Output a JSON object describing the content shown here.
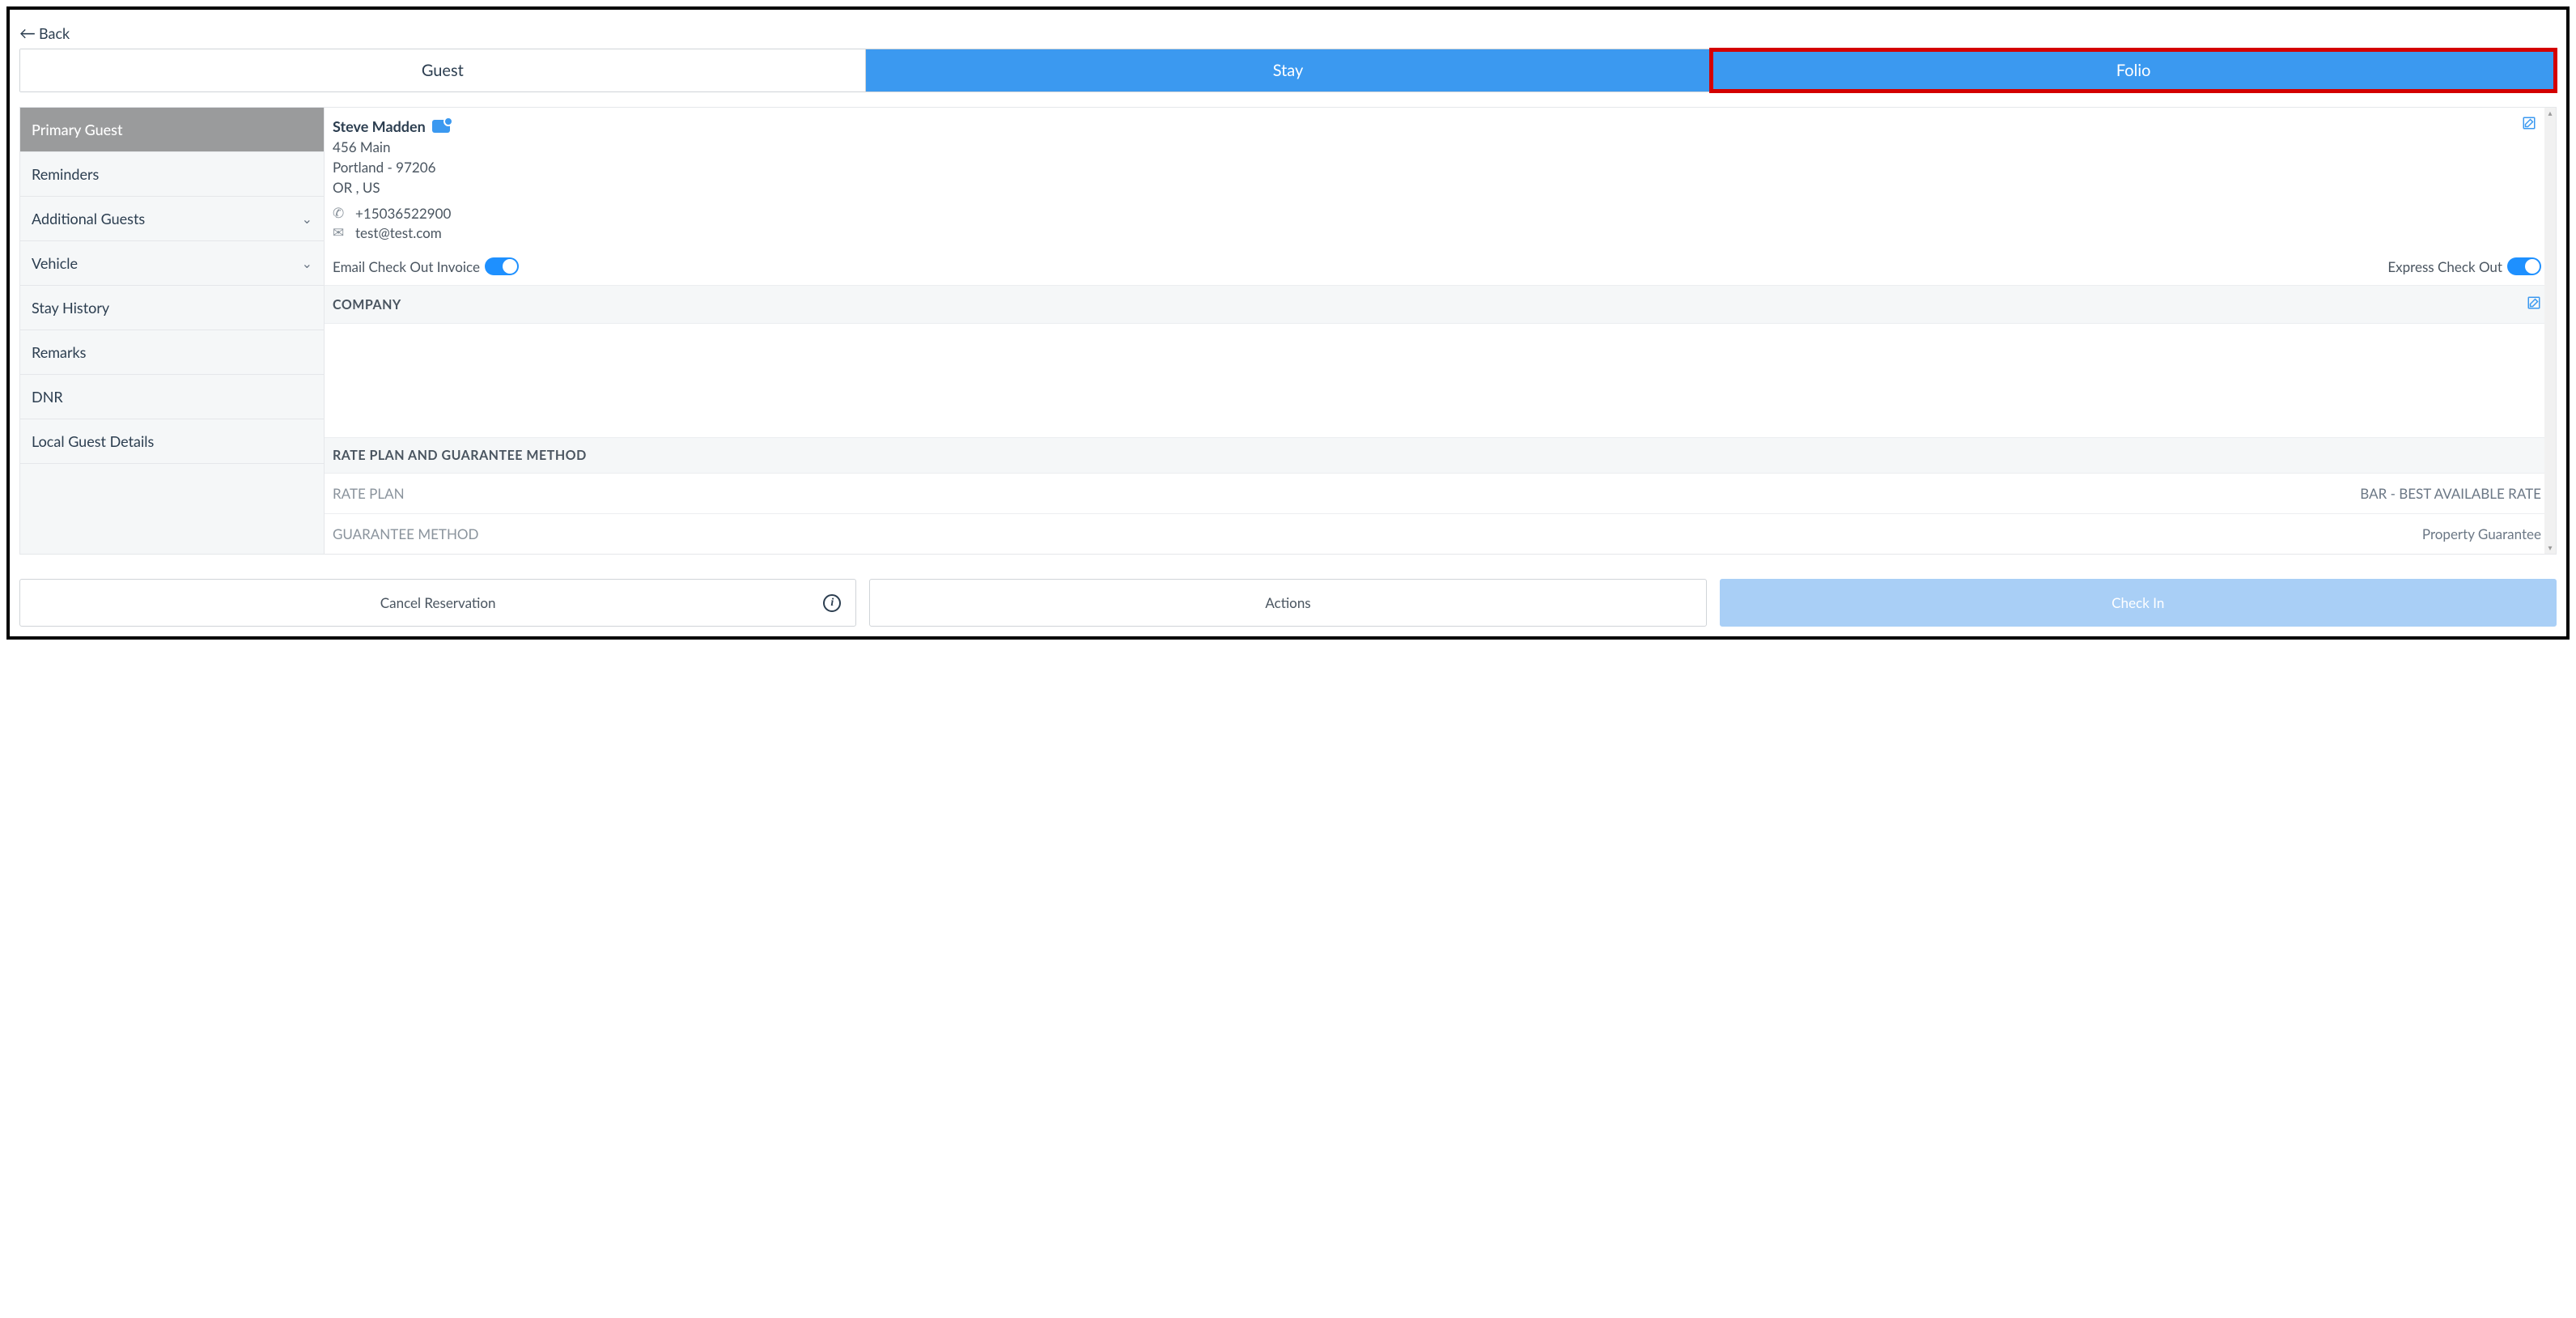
{
  "back_label": "Back",
  "tabs": {
    "guest": "Guest",
    "stay": "Stay",
    "folio": "Folio"
  },
  "sidebar": {
    "items": [
      {
        "label": "Primary Guest",
        "active": true
      },
      {
        "label": "Reminders"
      },
      {
        "label": "Additional Guests",
        "chevron": true
      },
      {
        "label": "Vehicle",
        "chevron": true
      },
      {
        "label": "Stay History"
      },
      {
        "label": "Remarks"
      },
      {
        "label": "DNR"
      },
      {
        "label": "Local Guest Details"
      }
    ]
  },
  "guest": {
    "name": "Steve Madden",
    "addr1": "456 Main",
    "addr2": "Portland  - 97206",
    "addr3": "OR , US",
    "phone": "+15036522900",
    "email": "test@test.com",
    "email_checkout_label": "Email Check Out Invoice",
    "express_checkout_label": "Express Check Out"
  },
  "sections": {
    "company": "COMPANY",
    "rate_plan_heading": "RATE PLAN AND GUARANTEE METHOD",
    "rate_plan_label": "RATE PLAN",
    "rate_plan_value": "BAR - BEST AVAILABLE RATE",
    "guarantee_label": "GUARANTEE METHOD",
    "guarantee_value": "Property Guarantee"
  },
  "footer": {
    "cancel": "Cancel Reservation",
    "actions": "Actions",
    "checkin": "Check In"
  }
}
